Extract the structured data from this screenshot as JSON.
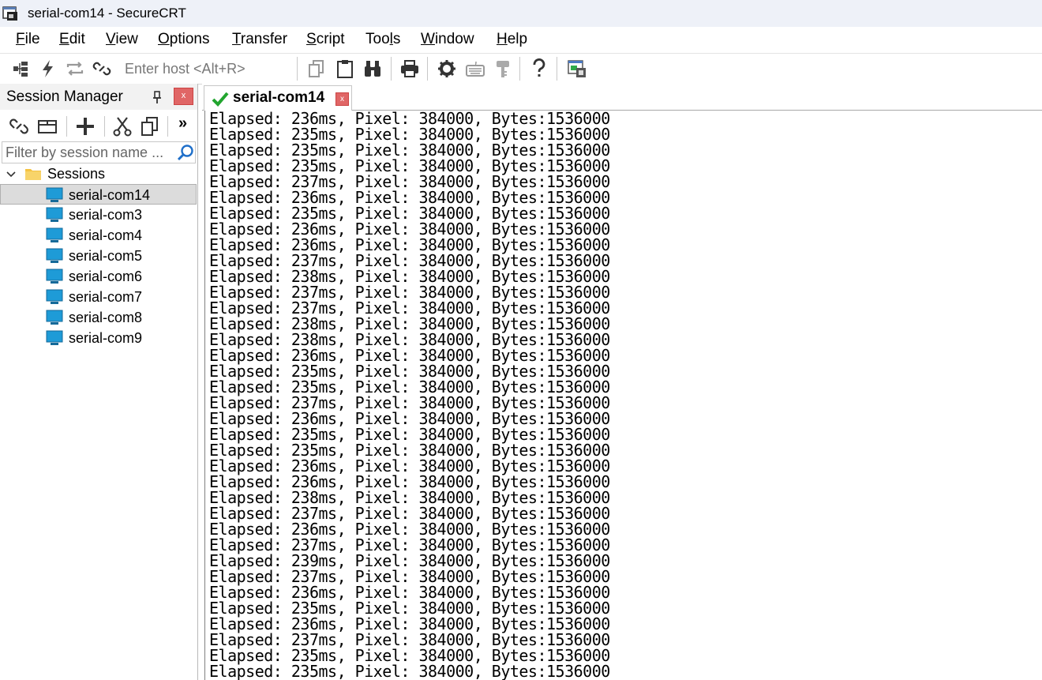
{
  "window": {
    "title": "serial-com14 - SecureCRT"
  },
  "menu": [
    {
      "pre": "",
      "acc": "F",
      "post": "ile"
    },
    {
      "pre": "",
      "acc": "E",
      "post": "dit"
    },
    {
      "pre": "",
      "acc": "V",
      "post": "iew"
    },
    {
      "pre": "",
      "acc": "O",
      "post": "ptions"
    },
    {
      "pre": "",
      "acc": "T",
      "post": "ransfer"
    },
    {
      "pre": "",
      "acc": "S",
      "post": "cript"
    },
    {
      "pre": "Too",
      "acc": "l",
      "post": "s"
    },
    {
      "pre": "",
      "acc": "W",
      "post": "indow"
    },
    {
      "pre": "",
      "acc": "H",
      "post": "elp"
    }
  ],
  "toolbar": {
    "host_placeholder": "Enter host <Alt+R>",
    "icons": [
      "connect-in-tab-icon",
      "quick-connect-icon",
      "reconnect-icon",
      "disconnect-icon",
      "copy-icon",
      "paste-icon",
      "find-icon",
      "print-icon",
      "settings-icon",
      "keymap-icon",
      "key-agent-icon",
      "help-icon",
      "sftp-icon"
    ]
  },
  "session_manager": {
    "title": "Session Manager",
    "close": "x",
    "more": "»",
    "filter_placeholder": "Filter by session name ...",
    "root_folder": "Sessions",
    "sessions": [
      {
        "label": "serial-com14",
        "selected": true
      },
      {
        "label": "serial-com3",
        "selected": false
      },
      {
        "label": "serial-com4",
        "selected": false
      },
      {
        "label": "serial-com5",
        "selected": false
      },
      {
        "label": "serial-com6",
        "selected": false
      },
      {
        "label": "serial-com7",
        "selected": false
      },
      {
        "label": "serial-com8",
        "selected": false
      },
      {
        "label": "serial-com9",
        "selected": false
      }
    ]
  },
  "tab": {
    "label": "serial-com14",
    "close": "x",
    "status": "connected"
  },
  "terminal": {
    "lines": [
      "Elapsed: 236ms, Pixel: 384000, Bytes:1536000",
      "Elapsed: 235ms, Pixel: 384000, Bytes:1536000",
      "Elapsed: 235ms, Pixel: 384000, Bytes:1536000",
      "Elapsed: 235ms, Pixel: 384000, Bytes:1536000",
      "Elapsed: 237ms, Pixel: 384000, Bytes:1536000",
      "Elapsed: 236ms, Pixel: 384000, Bytes:1536000",
      "Elapsed: 235ms, Pixel: 384000, Bytes:1536000",
      "Elapsed: 236ms, Pixel: 384000, Bytes:1536000",
      "Elapsed: 236ms, Pixel: 384000, Bytes:1536000",
      "Elapsed: 237ms, Pixel: 384000, Bytes:1536000",
      "Elapsed: 238ms, Pixel: 384000, Bytes:1536000",
      "Elapsed: 237ms, Pixel: 384000, Bytes:1536000",
      "Elapsed: 237ms, Pixel: 384000, Bytes:1536000",
      "Elapsed: 238ms, Pixel: 384000, Bytes:1536000",
      "Elapsed: 238ms, Pixel: 384000, Bytes:1536000",
      "Elapsed: 236ms, Pixel: 384000, Bytes:1536000",
      "Elapsed: 235ms, Pixel: 384000, Bytes:1536000",
      "Elapsed: 235ms, Pixel: 384000, Bytes:1536000",
      "Elapsed: 237ms, Pixel: 384000, Bytes:1536000",
      "Elapsed: 236ms, Pixel: 384000, Bytes:1536000",
      "Elapsed: 235ms, Pixel: 384000, Bytes:1536000",
      "Elapsed: 235ms, Pixel: 384000, Bytes:1536000",
      "Elapsed: 236ms, Pixel: 384000, Bytes:1536000",
      "Elapsed: 236ms, Pixel: 384000, Bytes:1536000",
      "Elapsed: 238ms, Pixel: 384000, Bytes:1536000",
      "Elapsed: 237ms, Pixel: 384000, Bytes:1536000",
      "Elapsed: 236ms, Pixel: 384000, Bytes:1536000",
      "Elapsed: 237ms, Pixel: 384000, Bytes:1536000",
      "Elapsed: 239ms, Pixel: 384000, Bytes:1536000",
      "Elapsed: 237ms, Pixel: 384000, Bytes:1536000",
      "Elapsed: 236ms, Pixel: 384000, Bytes:1536000",
      "Elapsed: 235ms, Pixel: 384000, Bytes:1536000",
      "Elapsed: 236ms, Pixel: 384000, Bytes:1536000",
      "Elapsed: 237ms, Pixel: 384000, Bytes:1536000",
      "Elapsed: 235ms, Pixel: 384000, Bytes:1536000",
      "Elapsed: 235ms, Pixel: 384000, Bytes:1536000"
    ]
  },
  "colors": {
    "session_icon": "#1e9bd7",
    "folder": "#f5c342",
    "check": "#22a52f",
    "close_button": "#e06666"
  }
}
